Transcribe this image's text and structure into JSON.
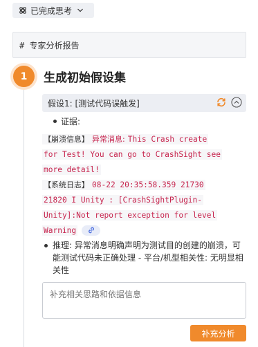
{
  "status_chip": {
    "label": "已完成思考",
    "icon": "brain-icon",
    "chevron": "chevron-down-icon"
  },
  "report": {
    "heading": "# 专家分析报告"
  },
  "step": {
    "number": "1",
    "title": "生成初始假设集",
    "accent_color": "#f08a2c"
  },
  "hypothesis": {
    "header": "假设1: [测试代码误触发]",
    "refresh_icon": "refresh-icon",
    "collapse_icon": "chevron-up-icon"
  },
  "evidence": {
    "label": "证据:",
    "crash_label": "【崩溃信息】",
    "crash_key": "异常消息:",
    "crash_line1": "This Crash create",
    "crash_line2": "for Test! You can go to CrashSight see",
    "crash_line3": "more detail!",
    "log_label": "【系统日志】",
    "log_line1": "08-22 20:35:58.359 21730",
    "log_line2": "21820 I Unity   : [CrashSightPlugin-",
    "log_line3": "Unity]:Not report exception for level",
    "log_line4": "Warning",
    "link_icon": "link-icon"
  },
  "reasoning": {
    "text": "推理: 异常消息明确声明为测试目的创建的崩溃，可能测试代码未正确处理 - 平台/机型相关性: 无明显相关性"
  },
  "supplement": {
    "placeholder": "补充相关思路和依据信息",
    "button_label": "补充分析"
  }
}
